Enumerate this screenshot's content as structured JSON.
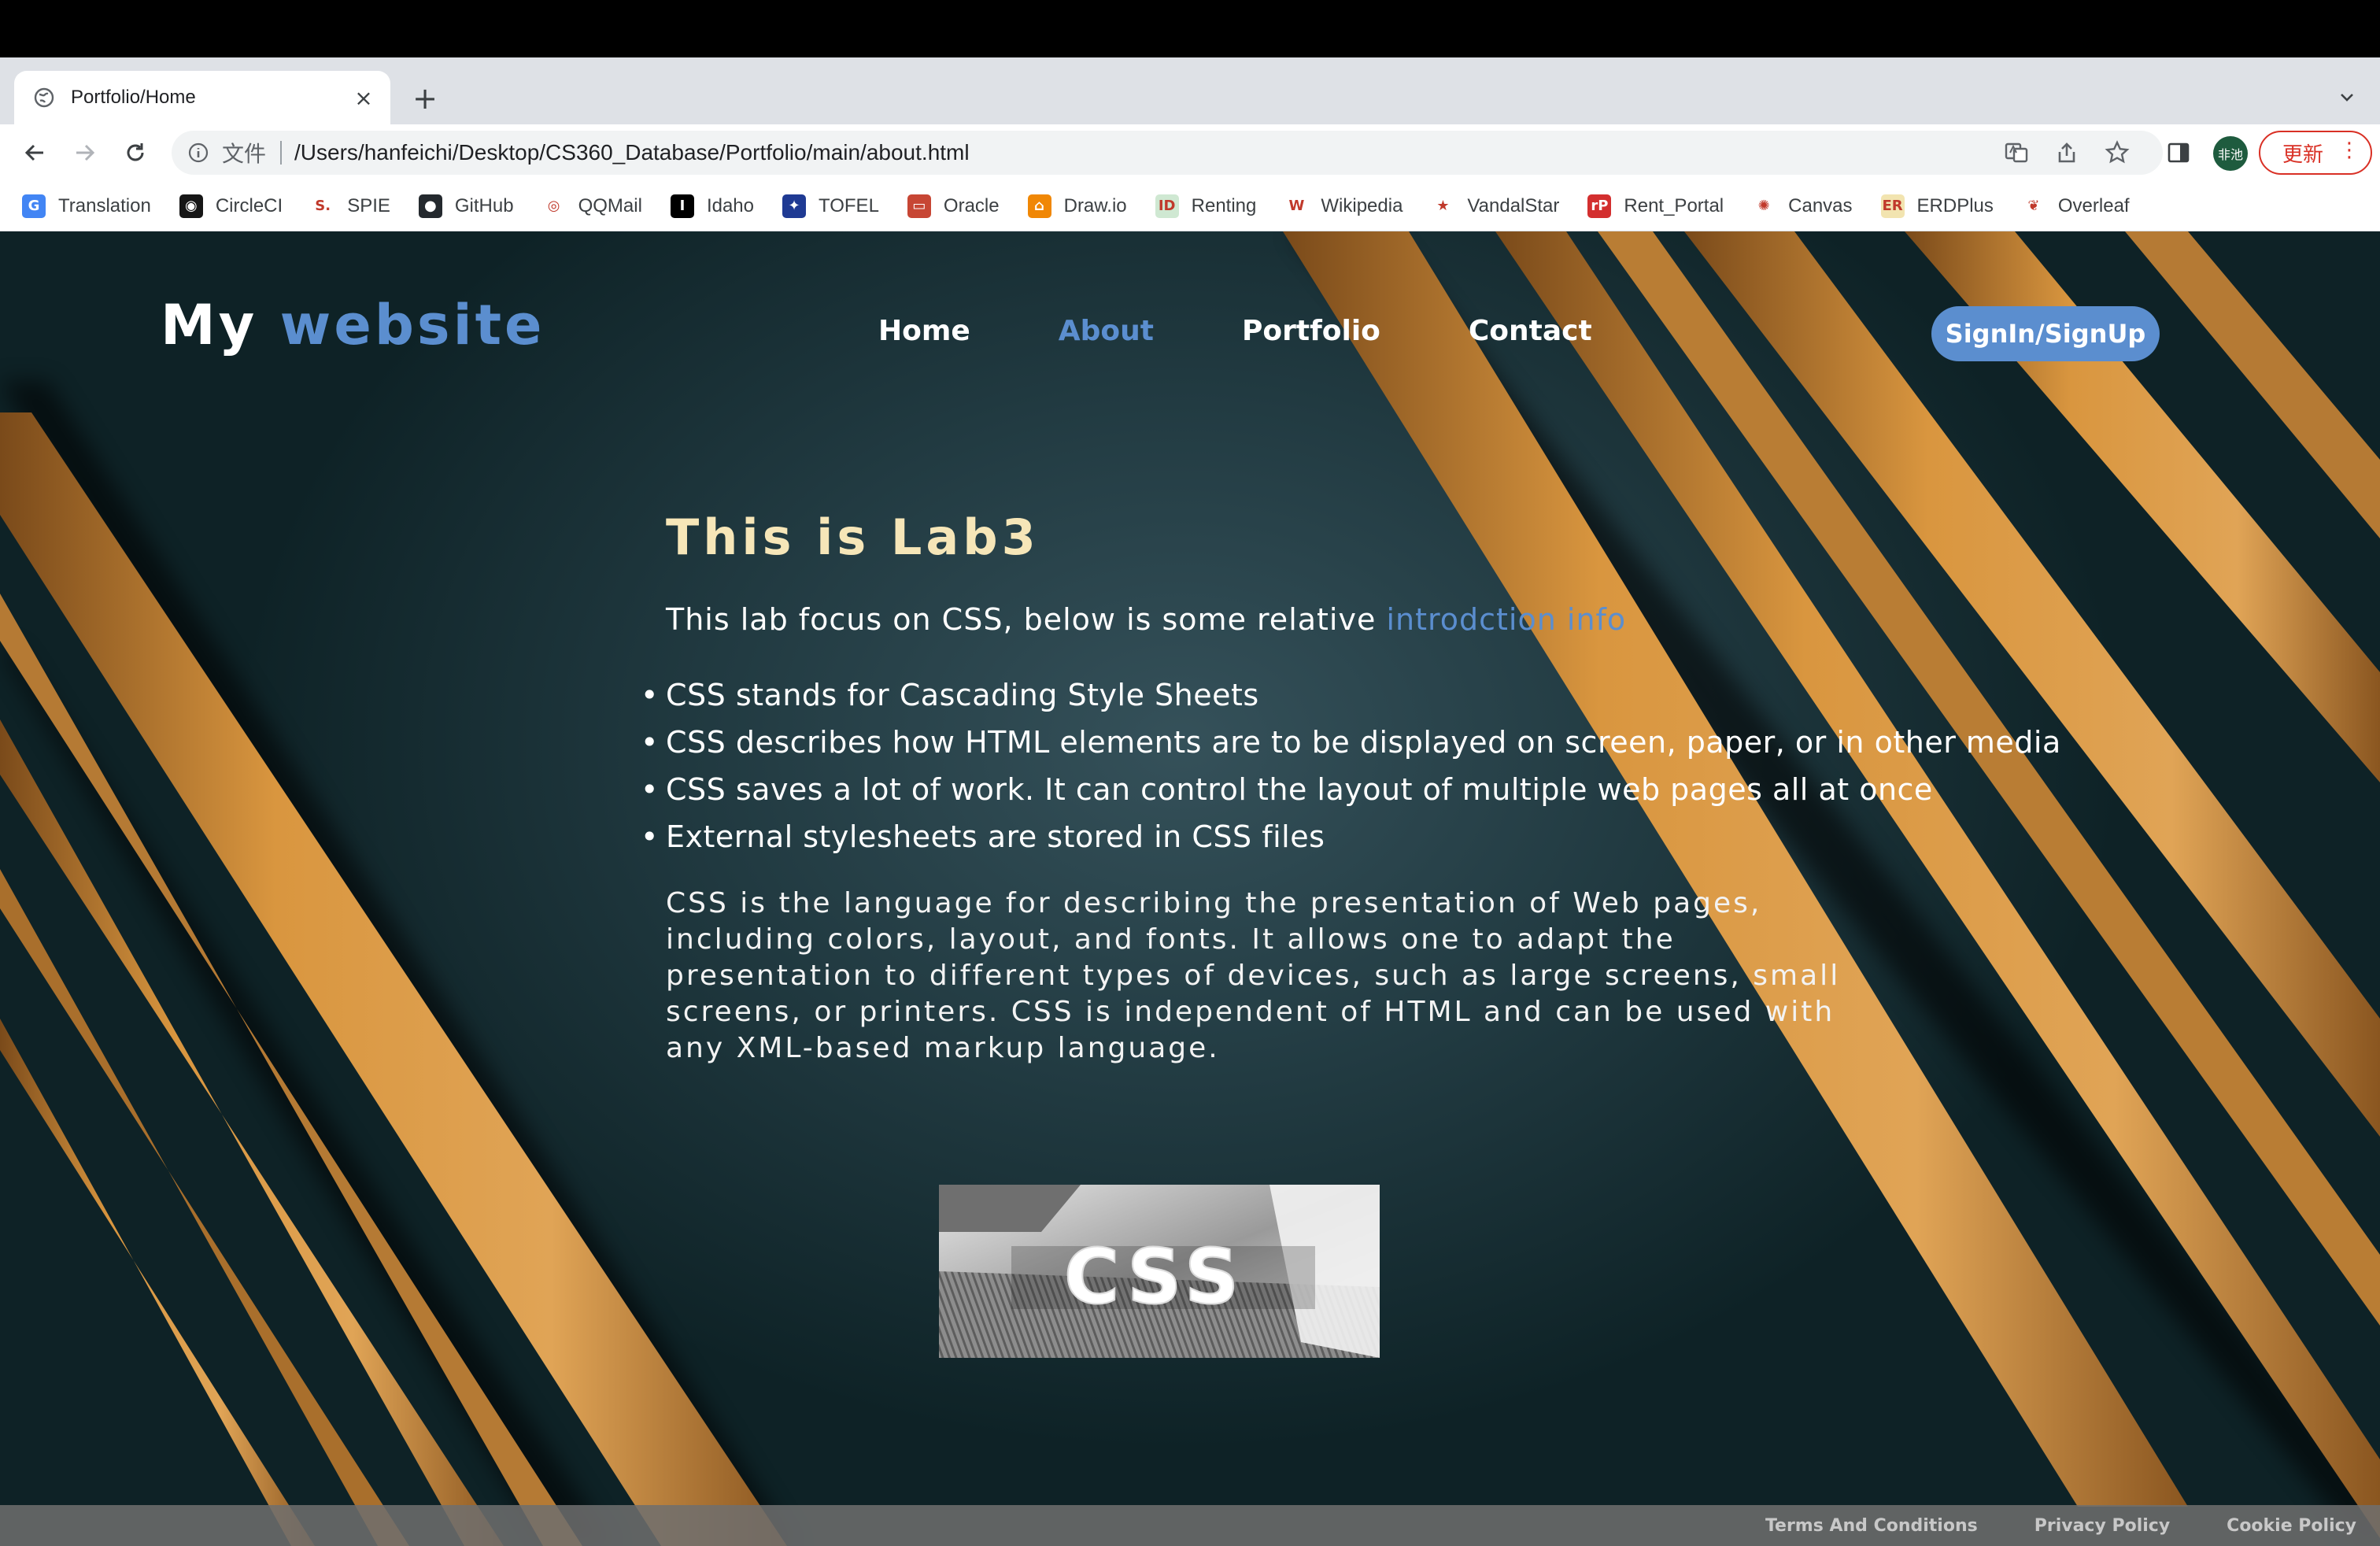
{
  "browser": {
    "tab_title": "Portfolio/Home",
    "tab_close": "×",
    "new_tab": "+",
    "scheme_label": "文件",
    "url": "/Users/hanfeichi/Desktop/CS360_Database/Portfolio/main/about.html",
    "profile_label": "非池",
    "update_label": "更新",
    "update_menu": "⋮"
  },
  "bookmarks": [
    {
      "label": "Translation",
      "icon": "google-translate-icon",
      "color": "#4285f4",
      "glyph": "G"
    },
    {
      "label": "CircleCI",
      "icon": "circleci-icon",
      "color": "#161616",
      "glyph": "◉"
    },
    {
      "label": "SPIE",
      "icon": "spie-icon",
      "color": "#ffffff",
      "glyph": "S."
    },
    {
      "label": "GitHub",
      "icon": "github-icon",
      "color": "#24292e",
      "glyph": "●"
    },
    {
      "label": "QQMail",
      "icon": "qqmail-icon",
      "color": "#ffffff",
      "glyph": "◎"
    },
    {
      "label": "Idaho",
      "icon": "idaho-icon",
      "color": "#000000",
      "glyph": "I"
    },
    {
      "label": "TOFEL",
      "icon": "tofel-icon",
      "color": "#1f3a93",
      "glyph": "✦"
    },
    {
      "label": "Oracle",
      "icon": "oracle-icon",
      "color": "#c74634",
      "glyph": "▭"
    },
    {
      "label": "Draw.io",
      "icon": "drawio-icon",
      "color": "#f08705",
      "glyph": "⌂"
    },
    {
      "label": "Renting",
      "icon": "renting-icon",
      "color": "#cfe8d2",
      "glyph": "ID"
    },
    {
      "label": "Wikipedia",
      "icon": "wikipedia-icon",
      "color": "#ffffff",
      "glyph": "W"
    },
    {
      "label": "VandalStar",
      "icon": "vandalstar-icon",
      "color": "#ffffff",
      "glyph": "★"
    },
    {
      "label": "Rent_Portal",
      "icon": "rent-portal-icon",
      "color": "#d32f2f",
      "glyph": "rP"
    },
    {
      "label": "Canvas",
      "icon": "canvas-icon",
      "color": "#ffffff",
      "glyph": "✺"
    },
    {
      "label": "ERDPlus",
      "icon": "erdplus-icon",
      "color": "#f2e4b0",
      "glyph": "ER"
    },
    {
      "label": "Overleaf",
      "icon": "overleaf-icon",
      "color": "#ffffff",
      "glyph": "❦"
    }
  ],
  "site": {
    "logo_main": "My",
    "logo_accent": "website",
    "nav": [
      "Home",
      "About",
      "Portfolio",
      "Contact"
    ],
    "active_nav": "About",
    "signin_label": "SignIn/SignUp"
  },
  "content": {
    "heading": "This is Lab3",
    "intro_text": "This lab focus on CSS, below is some relative ",
    "intro_link": "introdction info",
    "bullets": [
      "CSS stands for Cascading Style Sheets",
      "CSS describes how HTML elements are to be displayed on screen, paper, or in other media",
      "CSS saves a lot of work. It can control the layout of multiple web pages all at once",
      "External stylesheets are stored in CSS files"
    ],
    "paragraph": "CSS is the language for describing the presentation of Web pages, including colors, layout, and fonts. It allows one to adapt the presentation to different types of devices, such as large screens, small screens, or printers. CSS is independent of HTML and can be used with any XML-based markup language.",
    "image_text": "CSS"
  },
  "footer": [
    "Terms And Conditions",
    "Privacy Policy",
    "Cookie Policy"
  ],
  "colors": {
    "accent": "#5b8ecf",
    "heading": "#f6e6b8",
    "background": "#213a41",
    "stripe": "#c98a3c"
  }
}
